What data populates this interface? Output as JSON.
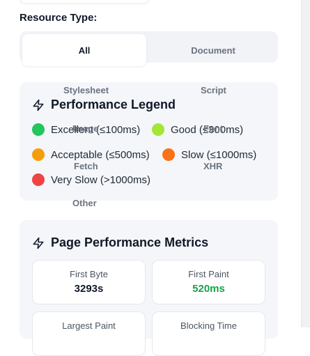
{
  "filters": {
    "resource_type_label": "Resource Type:",
    "tabs": [
      {
        "label": "All",
        "active": true
      },
      {
        "label": "Document",
        "active": false
      },
      {
        "label": "Stylesheet",
        "active": false
      },
      {
        "label": "Script",
        "active": false
      },
      {
        "label": "Image",
        "active": false
      },
      {
        "label": "Font",
        "active": false
      },
      {
        "label": "Fetch",
        "active": false
      },
      {
        "label": "XHR",
        "active": false
      },
      {
        "label": "Other",
        "active": false
      }
    ]
  },
  "legend": {
    "title": "Performance Legend",
    "icon": "lightning-icon",
    "items": [
      {
        "label": "Excellent (≤100ms)",
        "color": "#22c55e"
      },
      {
        "label": "Good (≤300ms)",
        "color": "#a3e635"
      },
      {
        "label": "Acceptable (≤500ms)",
        "color": "#f59e0b"
      },
      {
        "label": "Slow (≤1000ms)",
        "color": "#f97316"
      },
      {
        "label": "Very Slow (>1000ms)",
        "color": "#ef4444"
      }
    ]
  },
  "metrics": {
    "title": "Page Performance Metrics",
    "icon": "lightning-icon",
    "items": [
      {
        "label": "First Byte",
        "value": "3293s",
        "color": "#111827"
      },
      {
        "label": "First Paint",
        "value": "520ms",
        "color": "#16a34a"
      },
      {
        "label": "Largest Paint",
        "value": "",
        "color": "#111827"
      },
      {
        "label": "Blocking Time",
        "value": "",
        "color": "#111827"
      }
    ]
  },
  "colors": {
    "card_bg": "#f4f6f9",
    "tab_panel_bg": "#f1f3f7",
    "accent_green": "#16a34a"
  }
}
